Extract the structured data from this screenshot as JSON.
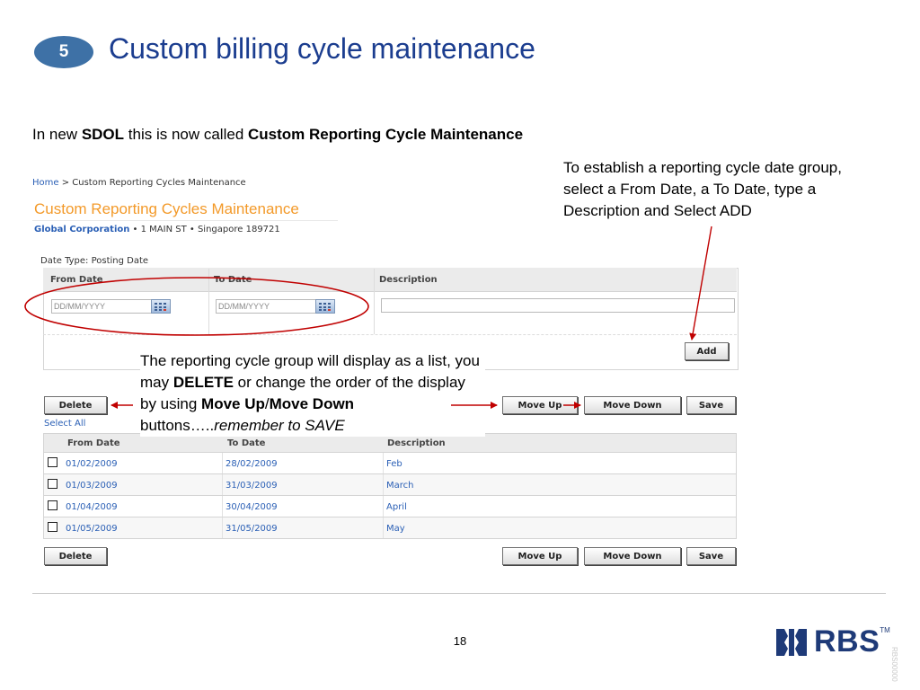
{
  "slide": {
    "step_number": "5",
    "title": "Custom billing cycle maintenance",
    "subtitle": {
      "prefix": "In new ",
      "bold1": "SDOL",
      "middle": " this is now called ",
      "bold2": "Custom Reporting Cycle Maintenance"
    },
    "callout_add": "To establish a reporting cycle date group, select a From Date, a To Date, type a Description and Select ADD",
    "callout_list": {
      "p1": "The reporting cycle group will display as a list, you may ",
      "b1": "DELETE",
      "p2": " or change the order of the display by using ",
      "b2": "Move Up",
      "p3": "/",
      "b3": "Move Down",
      "p4": " buttons…..",
      "i1": "remember to SAVE"
    },
    "page_number": "18",
    "logo": {
      "text": "RBS",
      "tm": "TM"
    },
    "side_code": "RBS00000"
  },
  "ui": {
    "breadcrumb": {
      "home": "Home",
      "separator": " > ",
      "current": "Custom Reporting Cycles Maintenance"
    },
    "page_heading": "Custom Reporting Cycles Maintenance",
    "company": {
      "name": "Global Corporation",
      "address": " • 1 MAIN ST • Singapore 189721"
    },
    "date_type": "Date Type: Posting Date",
    "entry": {
      "from_label": "From Date",
      "to_label": "To Date",
      "desc_label": "Description",
      "date_placeholder": "DD/MM/YYYY",
      "add_label": "Add"
    },
    "buttons": {
      "delete": "Delete",
      "move_up": "Move Up",
      "move_down": "Move Down",
      "save": "Save"
    },
    "select_all": "Select All",
    "table": {
      "headers": [
        "From Date",
        "To Date",
        "Description"
      ],
      "rows": [
        [
          "01/02/2009",
          "28/02/2009",
          "Feb"
        ],
        [
          "01/03/2009",
          "31/03/2009",
          "March"
        ],
        [
          "01/04/2009",
          "30/04/2009",
          "April"
        ],
        [
          "01/05/2009",
          "31/05/2009",
          "May"
        ]
      ]
    }
  },
  "colors": {
    "title_blue": "#1b3d8f",
    "badge_blue": "#3e71a6",
    "heading_orange": "#f39a2a",
    "link_blue": "#2a5fb5",
    "annotation_red": "#c00000"
  }
}
